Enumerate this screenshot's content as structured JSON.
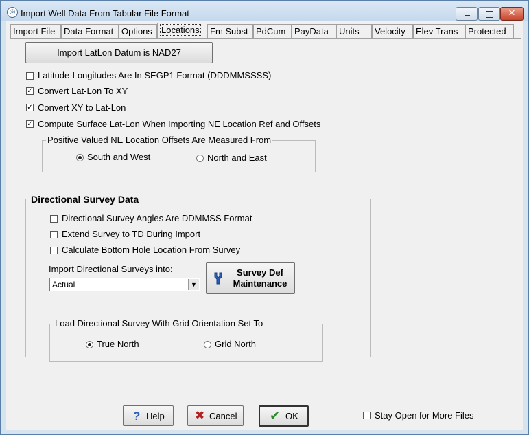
{
  "window": {
    "title": "Import Well Data From Tabular File Format"
  },
  "tabs": [
    {
      "label": "Import File"
    },
    {
      "label": "Data Format"
    },
    {
      "label": "Options"
    },
    {
      "label": "Locations"
    },
    {
      "label": "Fm Subst"
    },
    {
      "label": "PdCum"
    },
    {
      "label": "PayData"
    },
    {
      "label": "Units"
    },
    {
      "label": "Velocity"
    },
    {
      "label": "Elev Trans"
    },
    {
      "label": "Protected"
    }
  ],
  "locations": {
    "datum_button": "Import LatLon Datum is NAD27",
    "checks": [
      {
        "label": "Latitude-Longitudes Are In SEGP1 Format (DDDMMSSSS)",
        "checked": false
      },
      {
        "label": "Convert Lat-Lon To XY",
        "checked": true
      },
      {
        "label": "Convert XY to Lat-Lon",
        "checked": true
      },
      {
        "label": "Compute Surface Lat-Lon When Importing NE Location Ref and Offsets",
        "checked": true
      }
    ],
    "offsets_group": {
      "title": "Positive Valued NE Location Offsets Are Measured From",
      "options": [
        {
          "label": "South and West",
          "selected": true
        },
        {
          "label": "North and East",
          "selected": false
        }
      ]
    }
  },
  "directional": {
    "title": "Directional Survey Data",
    "checks": [
      {
        "label": "Directional Survey Angles Are DDMMSS Format",
        "checked": false
      },
      {
        "label": "Extend Survey to TD During Import",
        "checked": false
      },
      {
        "label": "Calculate Bottom Hole Location From Survey",
        "checked": false
      }
    ],
    "import_into_label": "Import Directional Surveys into:",
    "import_into_value": "Actual",
    "survey_def_line1": "Survey Def",
    "survey_def_line2": "Maintenance",
    "grid_group": {
      "title": "Load Directional Survey With Grid Orientation Set To",
      "options": [
        {
          "label": "True North",
          "selected": true
        },
        {
          "label": "Grid North",
          "selected": false
        }
      ]
    }
  },
  "footer": {
    "help": "Help",
    "cancel": "Cancel",
    "ok": "OK",
    "stay_open": "Stay Open for More Files",
    "stay_open_checked": false
  },
  "colors": {
    "accent_blue": "#2b5fb3",
    "cancel_red": "#b22222",
    "ok_green": "#2a8a2a",
    "titlebar": "#c4d8ec"
  },
  "icons": {
    "app": "app-icon",
    "help": "question-icon",
    "cancel": "x-icon",
    "ok": "check-icon",
    "survey_def": "wrench-icon"
  }
}
